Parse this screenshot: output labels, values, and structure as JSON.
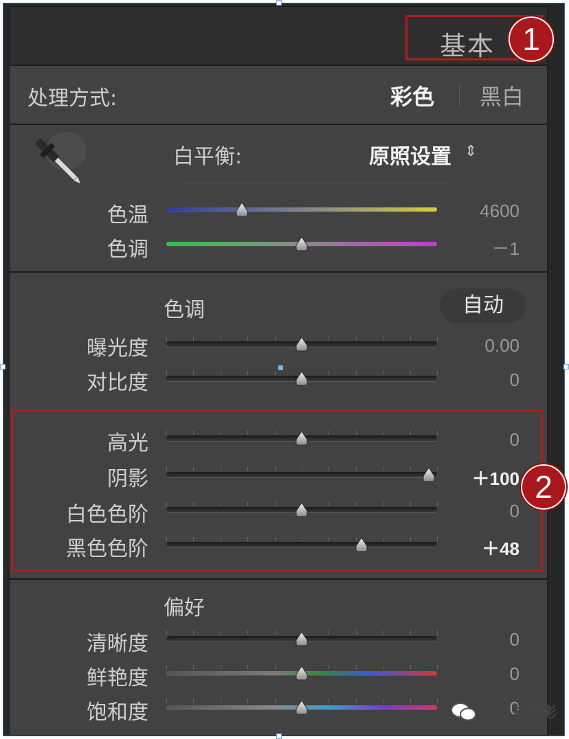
{
  "panel": {
    "title": "基本"
  },
  "badges": {
    "one": "1",
    "two": "2"
  },
  "treatment": {
    "label": "处理方式:",
    "color": "彩色",
    "bw": "黑白"
  },
  "wb": {
    "label": "白平衡:",
    "preset": "原照设置",
    "preset_arrows": "⇕"
  },
  "sliders": {
    "temp": {
      "label": "色温",
      "value": "4600",
      "fraction": 0.28
    },
    "tint": {
      "label": "色调",
      "value": "－1",
      "fraction": 0.5
    }
  },
  "tone": {
    "heading": "色调",
    "auto": "自动",
    "exposure": {
      "label": "曝光度",
      "value": "0.00",
      "fraction": 0.5
    },
    "contrast": {
      "label": "对比度",
      "value": "0",
      "fraction": 0.5
    },
    "highlights": {
      "label": "高光",
      "value": "0",
      "fraction": 0.5
    },
    "shadows": {
      "label": "阴影",
      "value": "＋100",
      "fraction": 0.97
    },
    "whites": {
      "label": "白色色阶",
      "value": "0",
      "fraction": 0.5
    },
    "blacks": {
      "label": "黑色色阶",
      "value": "＋48",
      "fraction": 0.72
    }
  },
  "presence": {
    "heading": "偏好",
    "clarity": {
      "label": "清晰度",
      "value": "0",
      "fraction": 0.5
    },
    "vibrance": {
      "label": "鲜艳度",
      "value": "0",
      "fraction": 0.5
    },
    "saturation": {
      "label": "饱和度",
      "value": "0",
      "fraction": 0.5
    }
  },
  "watermark": "好机友摄影",
  "colors": {
    "highlight": "#b01c1c",
    "panel": "#424242",
    "accent": "#6cb8f0"
  }
}
